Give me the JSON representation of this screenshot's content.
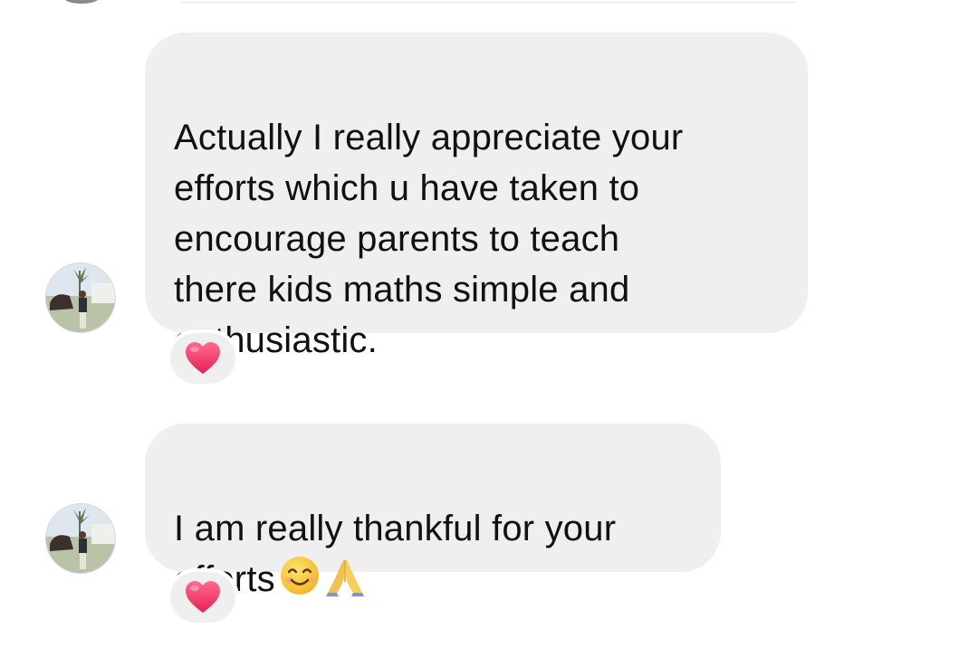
{
  "conversation": {
    "messages": [
      {
        "text": "Actually I really appreciate your\nefforts which u have taken to\nencourage parents to teach\nthere kids maths simple and\nenthusiastic.",
        "reaction": "heart-emoji"
      },
      {
        "text": "I am really thankful for your\nefforts",
        "emojis": [
          "smiling-face-emoji",
          "folded-hands-emoji"
        ],
        "reaction": "heart-emoji"
      }
    ]
  },
  "colors": {
    "bubble": "#efefef",
    "text": "#111111",
    "heart": "#f0386b",
    "background": "#ffffff"
  }
}
